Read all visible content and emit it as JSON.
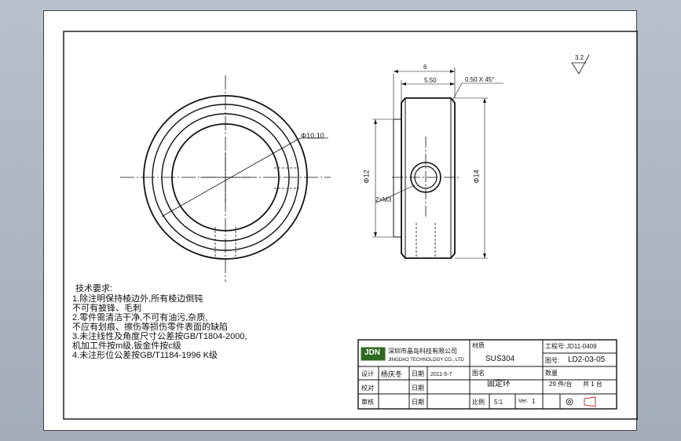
{
  "sheet": {
    "roughness_symbol": "3.2",
    "tech_notes_title": "技术要求:",
    "tech_notes": [
      "1.除注明保持棱边外,所有棱边倒钝",
      "  不可有披锋、毛刺",
      "2.零件需清洁干净,不可有油污,杂质,",
      "  不应有划痕、擦伤等损伤零件表面的缺陷",
      "3.未注线性及角度尺寸公差按GB/T1804-2000,",
      "  机加工件按m级,钣金件按c级",
      "4.未注形位公差按GB/T1184-1996 K级"
    ]
  },
  "dimensions": {
    "width_overall": "6",
    "width_inner": "5.50",
    "chamfer": "0.50 X 45°",
    "bore_dia": "Φ10.10",
    "dia_12": "Φ12",
    "dia_14": "Φ14",
    "thread": "2×M3"
  },
  "title_block": {
    "company_logo_text": "JDN",
    "company_name_cn": "深圳市晶岛科技有限公司",
    "company_name_en": "JINGDAO TECHNOLOGY CO., LTD",
    "material_label": "材质",
    "material_value": "SUS304",
    "project_no_label": "工程号:",
    "project_no_value": "JD11-0409",
    "drawing_no_label": "图号:",
    "drawing_no_value": "LD2-03-05",
    "designer_label": "设计",
    "designer_value": "杨庆冬",
    "date_label1": "日期",
    "date_value": "2011-5-7",
    "checker_label": "校对",
    "approver_label": "审核",
    "date_label2": "日期",
    "date_label3": "日期",
    "part_name_label": "图名",
    "part_name_value": "固定环",
    "quantity_label": "数量",
    "quantity_value": "29 件/台",
    "sets_value": "共 1 台",
    "scale_label": "比例",
    "scale_value": "5:1",
    "version_label": "Ver.",
    "version_value": "1"
  }
}
